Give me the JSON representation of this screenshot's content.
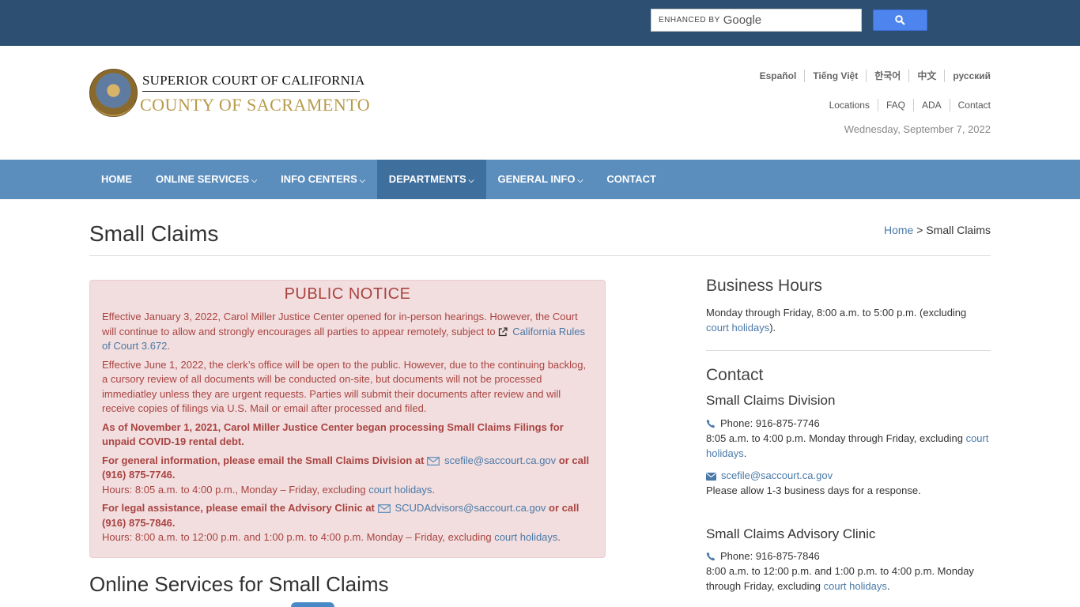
{
  "search": {
    "enhanced_by": "ENHANCED BY",
    "brand": "Google"
  },
  "header": {
    "court_line1": "SUPERIOR COURT OF CALIFORNIA",
    "court_line2": "COUNTY OF SACRAMENTO",
    "languages": [
      "Español",
      "Tiếng Việt",
      "한국어",
      "中文",
      "русский"
    ],
    "utility_links": [
      "Locations",
      "FAQ",
      "ADA",
      "Contact"
    ],
    "date": "Wednesday, September 7, 2022"
  },
  "nav": {
    "items": [
      {
        "label": "HOME"
      },
      {
        "label": "ONLINE SERVICES"
      },
      {
        "label": "INFO CENTERS"
      },
      {
        "label": "DEPARTMENTS"
      },
      {
        "label": "GENERAL INFO"
      },
      {
        "label": "CONTACT"
      }
    ],
    "active": "DEPARTMENTS"
  },
  "page": {
    "title": "Small Claims",
    "breadcrumb_home": "Home",
    "breadcrumb_sep": " > ",
    "breadcrumb_current": "Small Claims"
  },
  "notice": {
    "title": "PUBLIC NOTICE",
    "p1_text": "Effective January 3, 2022, Carol Miller Justice Center opened for in-person hearings. However, the Court will continue to allow and strongly encourages all parties to appear remotely, subject to ",
    "p1_link": "California Rules of Court 3.672",
    "p1_end": ".",
    "p2": "Effective June 1, 2022, the clerk’s office will be open to the public. However, due to the continuing backlog, a cursory review of all documents will be conducted on-site, but documents will not be processed immediatley unless they are urgent requests. Parties will submit their documents after review and will receive copies of filings via U.S. Mail or email after processed and filed.",
    "p3": "As of November 1, 2021, Carol Miller Justice Center began processing Small Claims Filings for unpaid COVID-19 rental debt.",
    "p4_a": "For general information, please email the Small Claims Division at ",
    "p4_email": "scefile@saccourt.ca.gov",
    "p4_b": " or call (916) 875-7746.",
    "p4_hours": "Hours: 8:05 a.m. to 4:00 p.m., Monday – Friday, excluding ",
    "p4_holidays": "court holidays",
    "p4_end": ".",
    "p5_a": "For legal assistance, please email the Advisory Clinic at ",
    "p5_email": "SCUDAdvisors@saccourt.ca.gov",
    "p5_b": " or call (916) 875-7846.",
    "p5_hours": "Hours: 8:00 a.m. to 12:00 p.m. and 1:00 p.m. to 4:00 p.m. Monday – Friday, excluding ",
    "p5_holidays": "court holidays",
    "p5_end": "."
  },
  "online_services_heading": "Online Services for Small Claims",
  "sidebar": {
    "hours_title": "Business Hours",
    "hours_text": "Monday through Friday, 8:00 a.m. to 5:00 p.m. (excluding ",
    "hours_link": "court holidays",
    "hours_end": ").",
    "contact_title": "Contact",
    "division_title": "Small Claims Division",
    "division_phone": "Phone: 916-875-7746",
    "division_hours": "8:05 a.m. to 4:00 p.m. Monday through Friday, excluding ",
    "division_holidays": "court holidays",
    "division_end": ".",
    "division_email": "scefile@saccourt.ca.gov",
    "division_note": "Please allow 1-3 business days for a response.",
    "clinic_title": "Small Claims Advisory Clinic",
    "clinic_phone": "Phone: 916-875-7846",
    "clinic_hours": "8:00 a.m. to 12:00 p.m. and 1:00 p.m. to 4:00 p.m. Monday through Friday, excluding ",
    "clinic_holidays": "court holidays",
    "clinic_end": "."
  },
  "colors": {
    "topbar": "#2c4f72",
    "navbar": "#5b8dbd",
    "nav_active": "#3f6f9d",
    "notice_bg": "#f2dede",
    "notice_text": "#a94442",
    "link": "#4a79a8",
    "gold": "#b89a4a"
  },
  "icons": [
    "search-icon",
    "court-seal",
    "external-link-icon",
    "envelope-icon",
    "phone-icon",
    "chevron-down-icon"
  ]
}
